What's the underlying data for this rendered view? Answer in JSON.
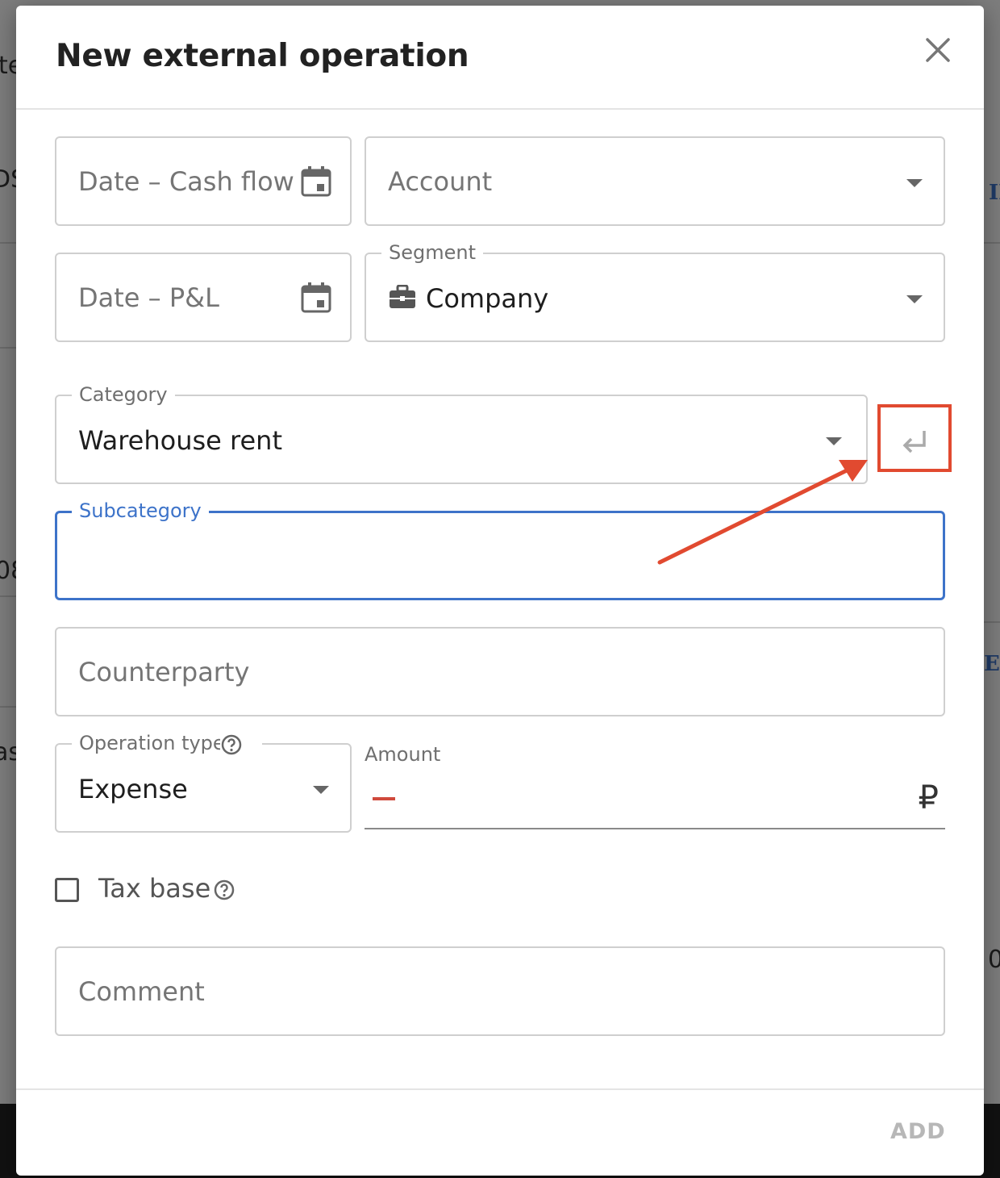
{
  "background": {
    "fragments": [
      "te",
      "DS",
      "08",
      "as",
      "II",
      "EF",
      "0"
    ]
  },
  "dialog": {
    "title": "New external operation",
    "fields": {
      "date_cash_flow": {
        "placeholder": "Date – Cash flow",
        "icon": "calendar-icon"
      },
      "account": {
        "placeholder": "Account"
      },
      "date_pl": {
        "placeholder": "Date – P&L",
        "icon": "calendar-icon"
      },
      "segment": {
        "label": "Segment",
        "value": "Company",
        "icon": "briefcase-icon"
      },
      "category": {
        "label": "Category",
        "value": "Warehouse rent"
      },
      "subcategory": {
        "label": "Subcategory",
        "value": ""
      },
      "counterparty": {
        "placeholder": "Counterparty"
      },
      "operation_type": {
        "label": "Operation type",
        "value": "Expense"
      },
      "amount": {
        "label": "Amount",
        "sign": "minus",
        "currency": "₽"
      },
      "tax_base": {
        "label": "Tax base",
        "checked": false
      },
      "comment": {
        "placeholder": "Comment"
      }
    },
    "add_label": "ADD"
  },
  "annotation": {
    "color": "#e14a30"
  },
  "colors": {
    "focus": "#3d73c9",
    "minus": "#d04a3c"
  }
}
